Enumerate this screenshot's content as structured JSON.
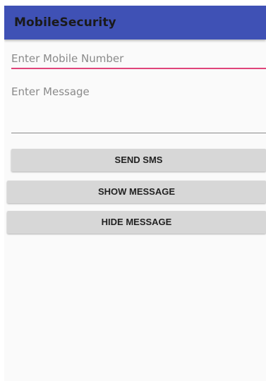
{
  "app_bar": {
    "title": "MobileSecurity",
    "background_color": "#3f51b5"
  },
  "form": {
    "mobile_number": {
      "placeholder": "Enter Mobile Number",
      "value": "",
      "focused": true,
      "accent_color": "#e0447a"
    },
    "message": {
      "placeholder": "Enter Message",
      "value": ""
    }
  },
  "buttons": {
    "send_sms": "SEND SMS",
    "show_message": "SHOW MESSAGE",
    "hide_message": "HIDE MESSAGE"
  }
}
